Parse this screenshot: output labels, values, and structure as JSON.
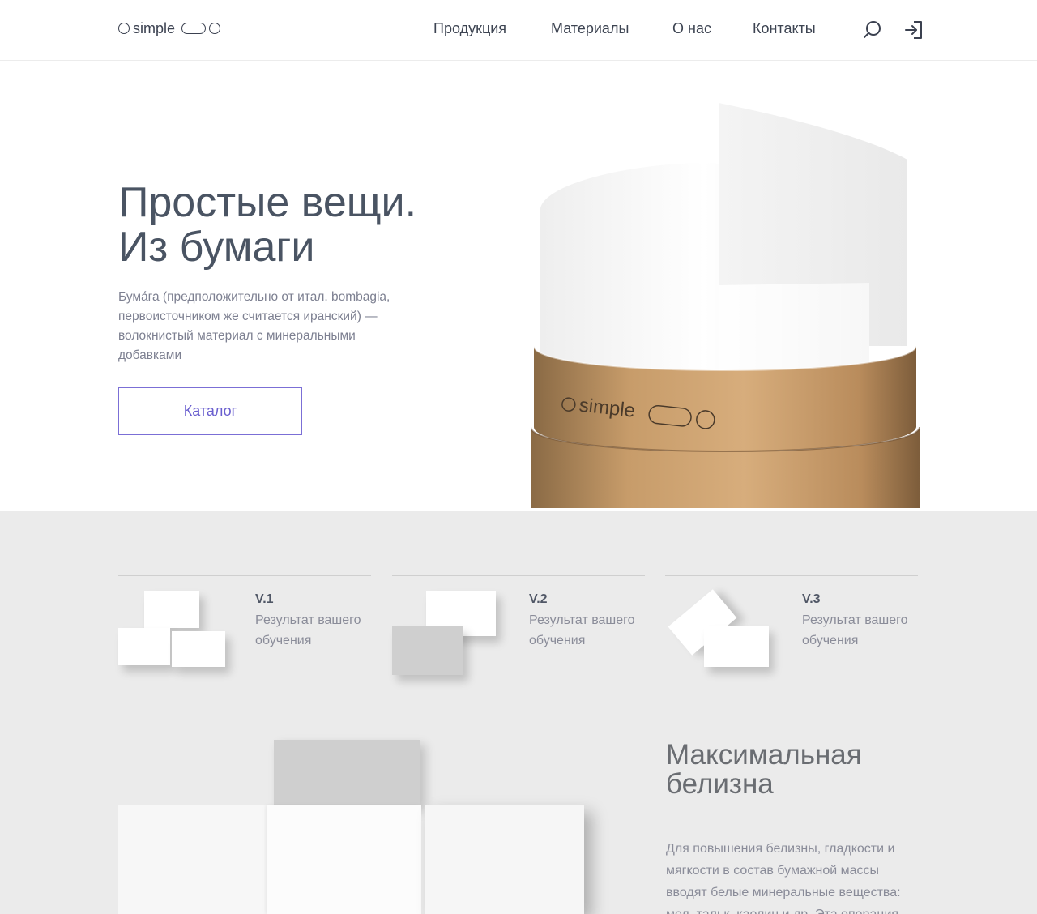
{
  "header": {
    "logo_text": "simple",
    "nav": [
      "Продукция",
      "Материалы",
      "О нас",
      "Контакты"
    ]
  },
  "hero": {
    "title_line1": "Простые вещи.",
    "title_line2": "Из бумаги",
    "text": "Бума́га (предположительно от итал. bombagia, первоисточником же считается иранский) — волокнистый материал с минеральными добавками",
    "button": "Каталог",
    "tube_logo": "simple"
  },
  "variants": [
    {
      "title": "V.1",
      "desc": "Результат вашего обучения"
    },
    {
      "title": "V.2",
      "desc": "Результат вашего обучения"
    },
    {
      "title": "V.3",
      "desc": "Результат вашего обучения"
    }
  ],
  "section": {
    "title_line1": "Максимальная",
    "title_line2": "белизна",
    "text": "Для повышения белизны, гладкости и мягкости в состав бумажной массы вводят белые минеральные вещества: мел, тальк, каолин и др. Эта операция"
  },
  "icons": {
    "search": "search-icon",
    "login": "login-icon"
  },
  "colors": {
    "accent": "#6a5fcf",
    "grey_bg": "#ebebeb",
    "text": "#4a5463"
  }
}
